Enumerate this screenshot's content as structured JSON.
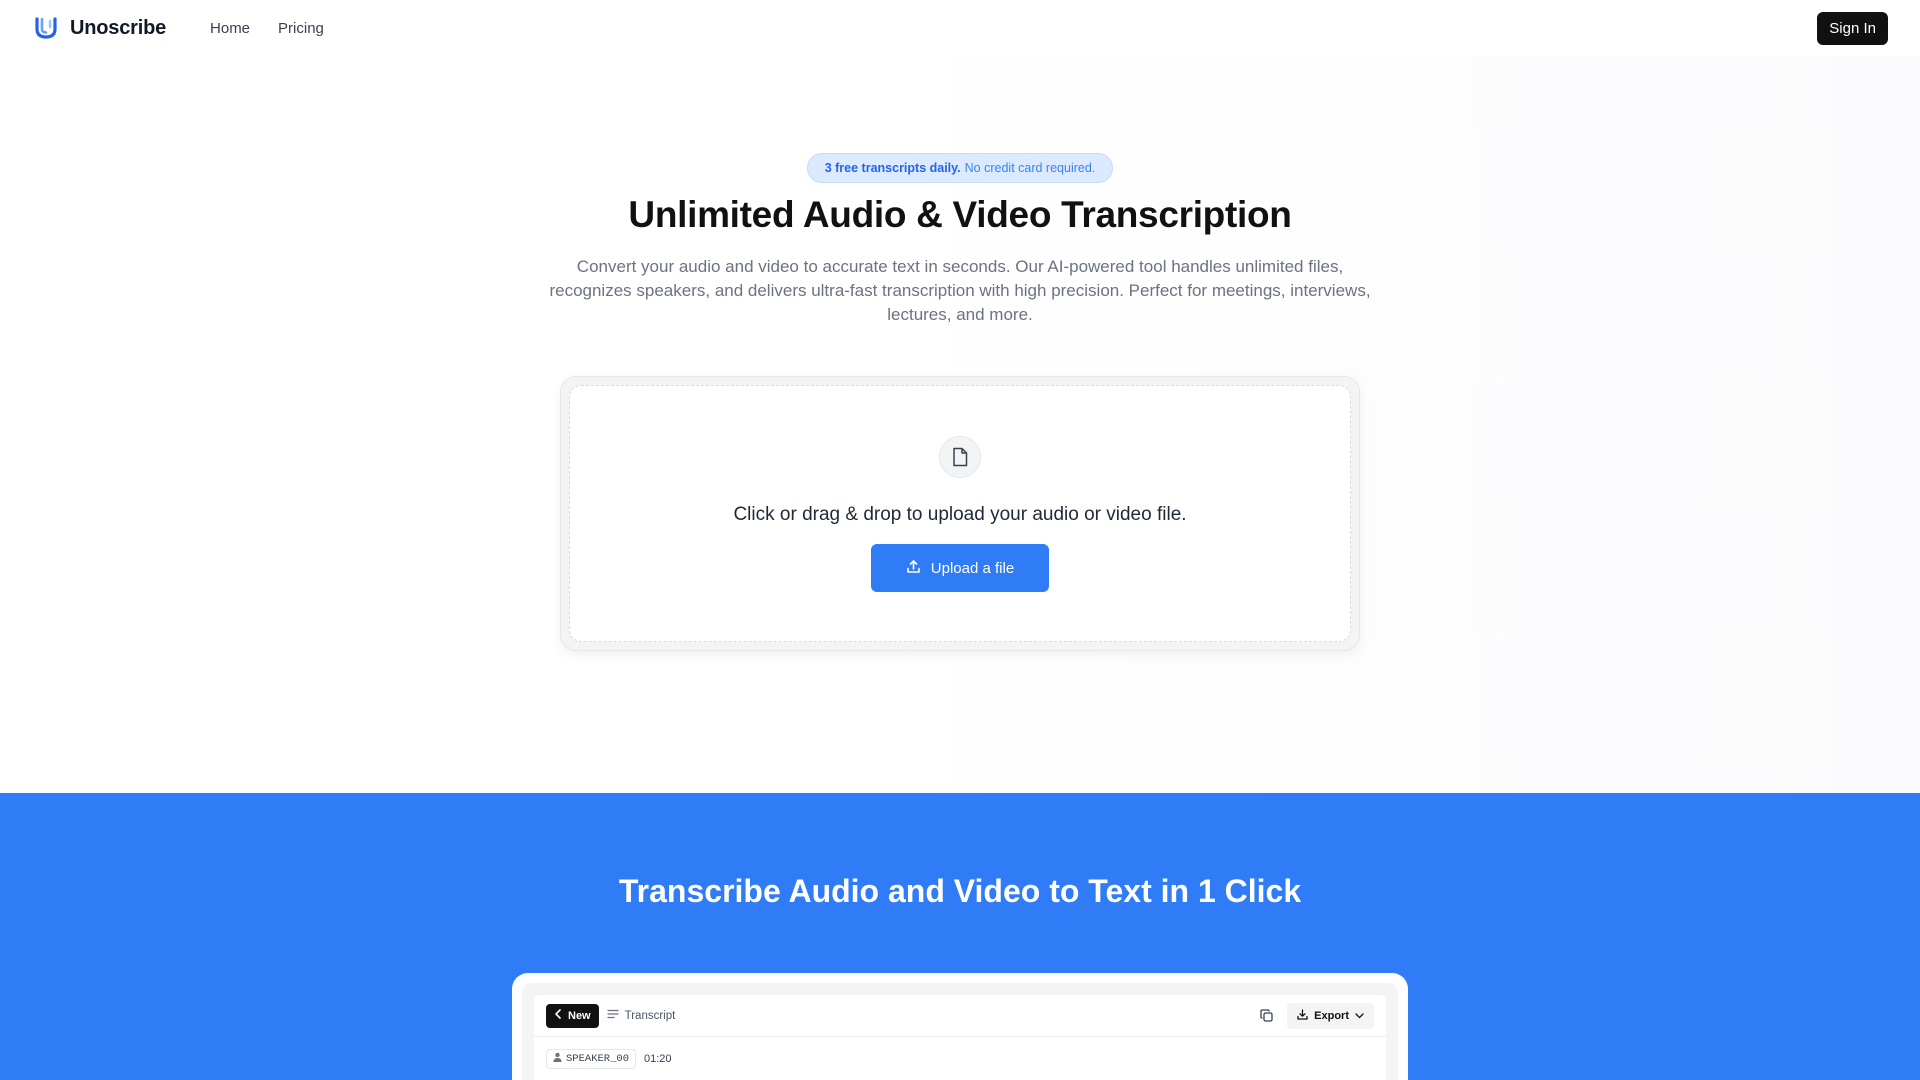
{
  "nav": {
    "brand": "Unoscribe",
    "links": [
      "Home",
      "Pricing"
    ],
    "signin_label": "Sign In"
  },
  "hero": {
    "promo_strong": "3 free transcripts daily.",
    "promo_rest": "No credit card required.",
    "title": "Unlimited Audio & Video Transcription",
    "description": "Convert your audio and video to accurate text in seconds. Our AI-powered tool handles unlimited files, recognizes speakers, and delivers ultra-fast transcription with high precision. Perfect for meetings, interviews, lectures, and more."
  },
  "upload": {
    "prompt": "Click or drag & drop to upload your audio or video file.",
    "button_label": "Upload a file"
  },
  "feature": {
    "title": "Transcribe Audio and Video to Text in 1 Click"
  },
  "preview": {
    "new_label": "New",
    "transcript_label": "Transcript",
    "export_label": "Export",
    "speaker": "SPEAKER_00",
    "timestamp": "01:20"
  },
  "colors": {
    "accent": "#2f7cf6",
    "dark": "#111111",
    "pill_bg": "#dbeafe"
  }
}
